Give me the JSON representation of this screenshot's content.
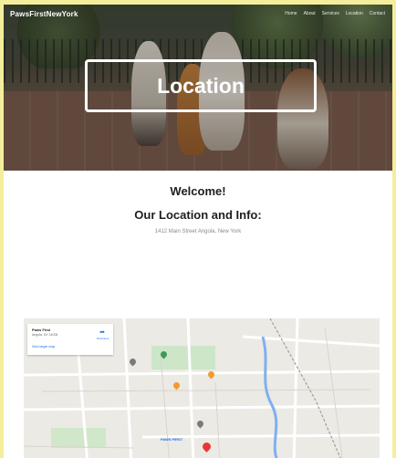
{
  "header": {
    "brand": "PawsFirstNewYork",
    "nav": [
      "Home",
      "About",
      "Services",
      "Location",
      "Contact"
    ]
  },
  "hero": {
    "title": "Location"
  },
  "content": {
    "welcome": "Welcome!",
    "heading": "Our Location and Info:",
    "address": "1412 Main Street Angola, New York"
  },
  "map": {
    "place_name": "Paws First",
    "place_address": "Angola, NY 14006",
    "view_larger": "View larger map",
    "directions_label": "Directions",
    "marker_label": "PAWS FIRST",
    "colors": {
      "water": "#7fb0f0",
      "road": "#ffffff",
      "park": "#c5e5bf",
      "marker": "#e53935",
      "poi_orange": "#f29a2e",
      "poi_green": "#3b9a5a"
    }
  }
}
